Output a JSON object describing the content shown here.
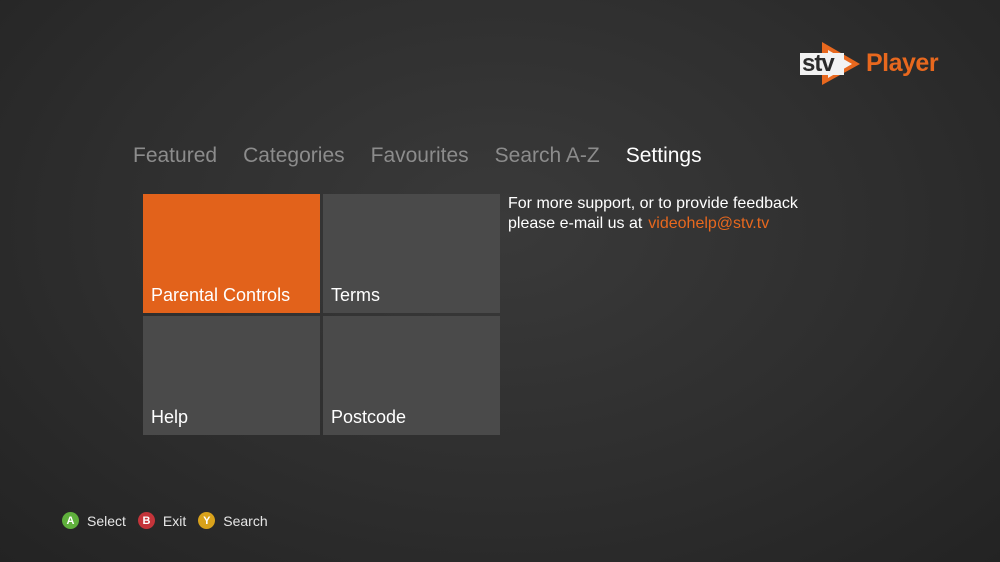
{
  "logo": {
    "mark_text": "stv",
    "player_text": "Player",
    "brand_color": "#e8681e"
  },
  "nav": {
    "items": [
      {
        "label": "Featured",
        "active": false
      },
      {
        "label": "Categories",
        "active": false
      },
      {
        "label": "Favourites",
        "active": false
      },
      {
        "label": "Search A-Z",
        "active": false
      },
      {
        "label": "Settings",
        "active": true
      }
    ]
  },
  "tiles": [
    {
      "label": "Parental Controls",
      "selected": true,
      "color": "#e2621b"
    },
    {
      "label": "Terms",
      "selected": false,
      "color": "#4a4a4a"
    },
    {
      "label": "Help",
      "selected": false,
      "color": "#4a4a4a"
    },
    {
      "label": "Postcode",
      "selected": false,
      "color": "#4a4a4a"
    }
  ],
  "support": {
    "line1": "For more support, or to provide feedback",
    "line2": "please e-mail us at",
    "email": "videohelp@stv.tv"
  },
  "hints": [
    {
      "button": "A",
      "label": "Select",
      "color": "#5fb03c",
      "icon": "a-button-icon"
    },
    {
      "button": "B",
      "label": "Exit",
      "color": "#c4343a",
      "icon": "b-button-icon"
    },
    {
      "button": "Y",
      "label": "Search",
      "color": "#d9a21b",
      "icon": "y-button-icon"
    }
  ]
}
